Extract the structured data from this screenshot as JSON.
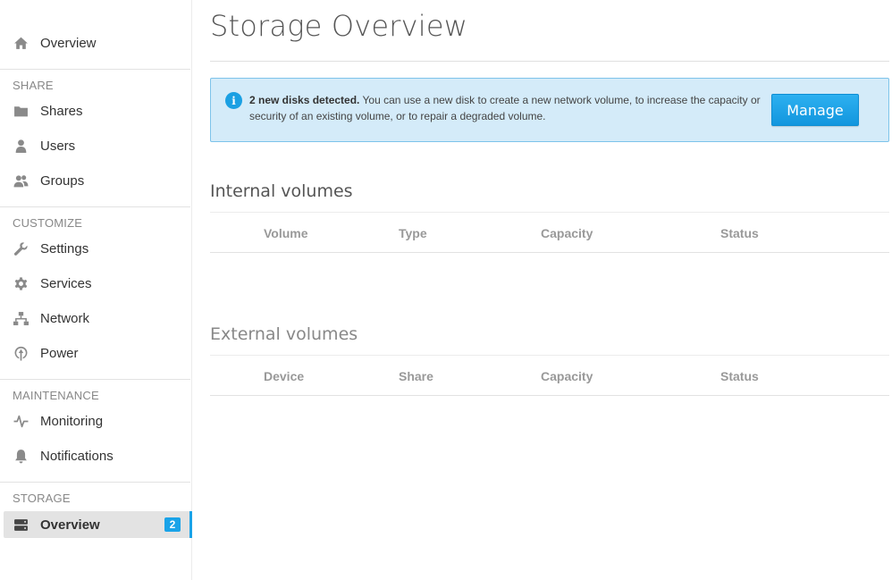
{
  "sidebar": {
    "top_item": {
      "label": "Overview",
      "icon": "home-icon"
    },
    "sections": [
      {
        "title": "SHARE",
        "items": [
          {
            "label": "Shares",
            "icon": "folder-icon"
          },
          {
            "label": "Users",
            "icon": "user-icon"
          },
          {
            "label": "Groups",
            "icon": "users-icon"
          }
        ]
      },
      {
        "title": "CUSTOMIZE",
        "items": [
          {
            "label": "Settings",
            "icon": "wrench-icon"
          },
          {
            "label": "Services",
            "icon": "gear-icon"
          },
          {
            "label": "Network",
            "icon": "network-icon"
          },
          {
            "label": "Power",
            "icon": "power-icon"
          }
        ]
      },
      {
        "title": "MAINTENANCE",
        "items": [
          {
            "label": "Monitoring",
            "icon": "pulse-icon"
          },
          {
            "label": "Notifications",
            "icon": "bell-icon"
          }
        ]
      },
      {
        "title": "STORAGE",
        "items": [
          {
            "label": "Overview",
            "icon": "drive-icon",
            "badge": "2",
            "active": true
          }
        ]
      }
    ]
  },
  "main": {
    "title": "Storage Overview",
    "alert": {
      "bold": "2 new disks detected.",
      "text": " You can use a new disk to create a new network volume, to increase the capacity or security of an existing volume, or to repair a degraded volume.",
      "button": "Manage"
    },
    "internal": {
      "title": "Internal volumes",
      "columns": [
        "Volume",
        "Type",
        "Capacity",
        "Status"
      ]
    },
    "external": {
      "title": "External volumes",
      "columns": [
        "Device",
        "Share",
        "Capacity",
        "Status"
      ]
    }
  },
  "colors": {
    "accent": "#1ba3ea",
    "alert_bg": "#d4ebf9",
    "alert_border": "#7dc3ea"
  }
}
